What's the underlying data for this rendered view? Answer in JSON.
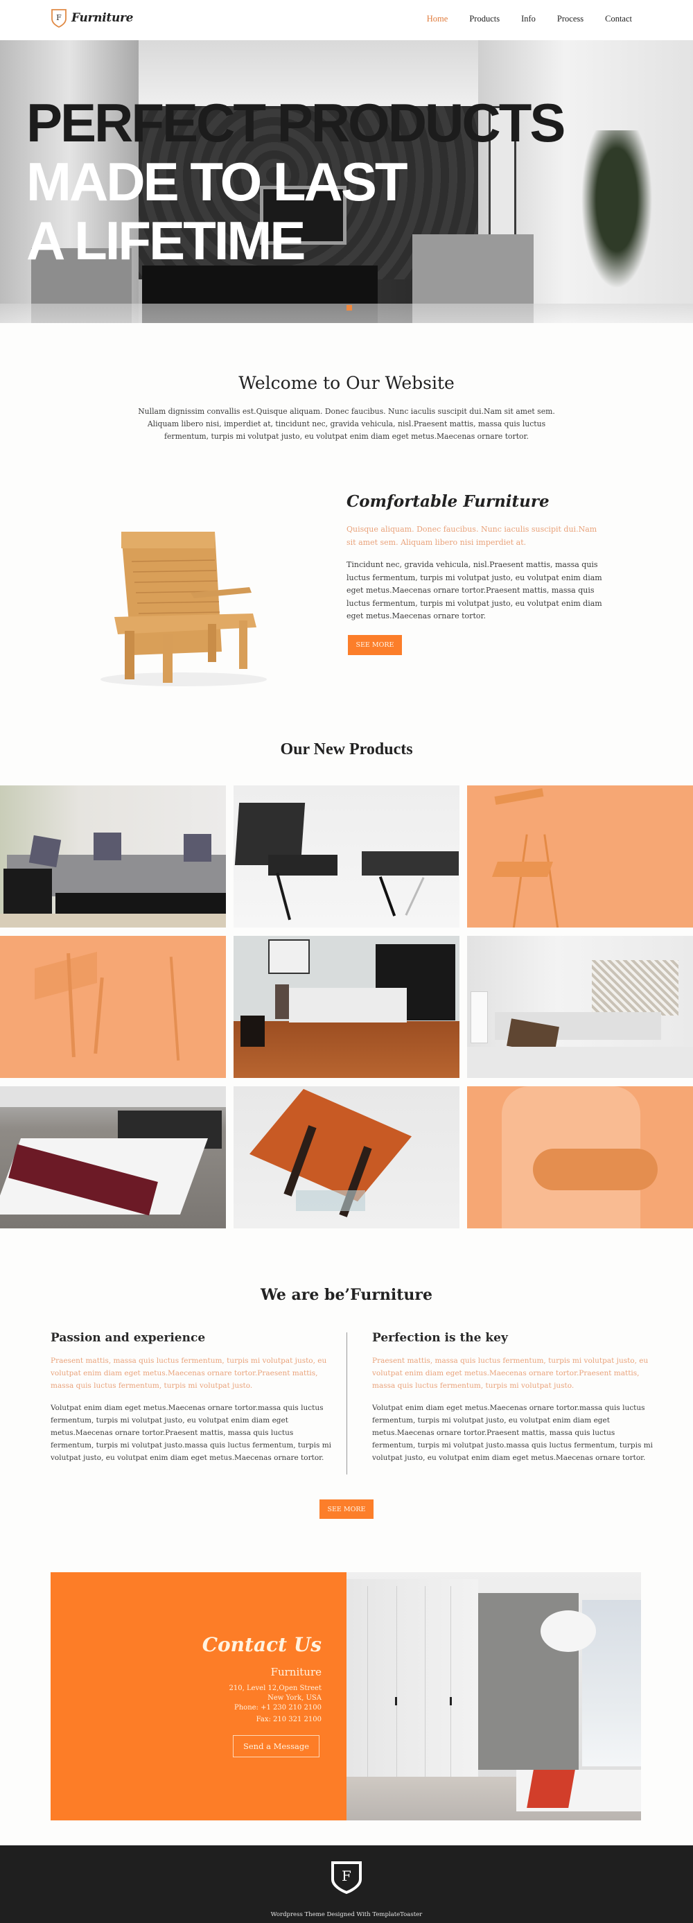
{
  "header": {
    "logo_letter": "F",
    "logo_text": "Furniture",
    "nav": [
      {
        "label": "Home",
        "active": true
      },
      {
        "label": "Products",
        "active": false
      },
      {
        "label": "Info",
        "active": false
      },
      {
        "label": "Process",
        "active": false
      },
      {
        "label": "Contact",
        "active": false
      }
    ]
  },
  "hero": {
    "lines": [
      "PERFECT PRODUCTS",
      "MADE TO LAST",
      "A LIFETIME"
    ],
    "slide_indicator_count": 1
  },
  "welcome": {
    "title": "Welcome to Our Website",
    "text": "Nullam dignissim convallis est.Quisque aliquam. Donec faucibus. Nunc iaculis suscipit dui.Nam sit amet sem. Aliquam libero nisi, imperdiet at, tincidunt nec, gravida vehicula, nisl.Praesent mattis, massa quis luctus fermentum, turpis mi volutpat justo, eu volutpat enim diam eget metus.Maecenas ornare tortor."
  },
  "feature": {
    "title": "Comfortable Furniture",
    "lead": "Quisque aliquam. Donec faucibus. Nunc iaculis suscipit dui.Nam sit amet sem. Aliquam libero nisi imperdiet at.",
    "body": "Tincidunt nec, gravida vehicula, nisl.Praesent mattis, massa quis luctus fermentum, turpis mi volutpat justo, eu volutpat enim diam eget metus.Maecenas ornare tortor.Praesent mattis, massa quis luctus fermentum, turpis mi volutpat justo, eu volutpat enim diam eget metus.Maecenas ornare tortor.",
    "button": "SEE MORE"
  },
  "products": {
    "title": "Our New Products",
    "items": [
      {
        "name": "sectional-sofa",
        "tint": "none"
      },
      {
        "name": "leather-chair-ottoman",
        "tint": "none"
      },
      {
        "name": "folding-chair",
        "tint": "orange"
      },
      {
        "name": "console-table",
        "tint": "orange"
      },
      {
        "name": "bedroom-wood-floor",
        "tint": "none"
      },
      {
        "name": "white-bed-room",
        "tint": "none"
      },
      {
        "name": "bed-burgundy-throw",
        "tint": "none"
      },
      {
        "name": "wooden-coffee-table",
        "tint": "none"
      },
      {
        "name": "bathroom-vanity",
        "tint": "orange"
      }
    ]
  },
  "about": {
    "title": "We are be’Furniture",
    "columns": [
      {
        "heading": "Passion and experience",
        "lead": "Praesent mattis, massa quis luctus fermentum, turpis mi volutpat justo, eu volutpat enim diam eget metus.Maecenas ornare tortor.Praesent mattis, massa quis luctus fermentum, turpis mi volutpat justo.",
        "body": "Volutpat enim diam eget metus.Maecenas ornare tortor.massa quis luctus fermentum, turpis mi volutpat justo, eu volutpat enim diam eget metus.Maecenas ornare tortor.Praesent mattis, massa quis luctus fermentum, turpis mi volutpat justo.massa quis luctus fermentum, turpis mi volutpat justo, eu volutpat enim diam eget metus.Maecenas ornare tortor."
      },
      {
        "heading": "Perfection is the key",
        "lead": "Praesent mattis, massa quis luctus fermentum, turpis mi volutpat justo, eu volutpat enim diam eget metus.Maecenas ornare tortor.Praesent mattis, massa quis luctus fermentum, turpis mi volutpat justo.",
        "body": "Volutpat enim diam eget metus.Maecenas ornare tortor.massa quis luctus fermentum, turpis mi volutpat justo, eu volutpat enim diam eget metus.Maecenas ornare tortor.Praesent mattis, massa quis luctus fermentum, turpis mi volutpat justo.massa quis luctus fermentum, turpis mi volutpat justo, eu volutpat enim diam eget metus.Maecenas ornare tortor."
      }
    ],
    "button": "SEE MORE"
  },
  "contact": {
    "title": "Contact Us",
    "company": "Furniture",
    "address_1": "210, Level 12,Open Street",
    "address_2": "New York, USA",
    "phone": "Phone: +1 230 210 2100",
    "fax": "Fax: 210 321 2100",
    "button": "Send a Message"
  },
  "footer": {
    "logo_letter": "F",
    "text": "Wordpress Theme Designed With TemplateToaster"
  },
  "colors": {
    "accent": "#fc7e2a",
    "accent_light": "#e9a27a",
    "nav_active": "#e07b3c",
    "tile_tint": "#f6a774",
    "footer_bg": "#1f1f1f"
  }
}
